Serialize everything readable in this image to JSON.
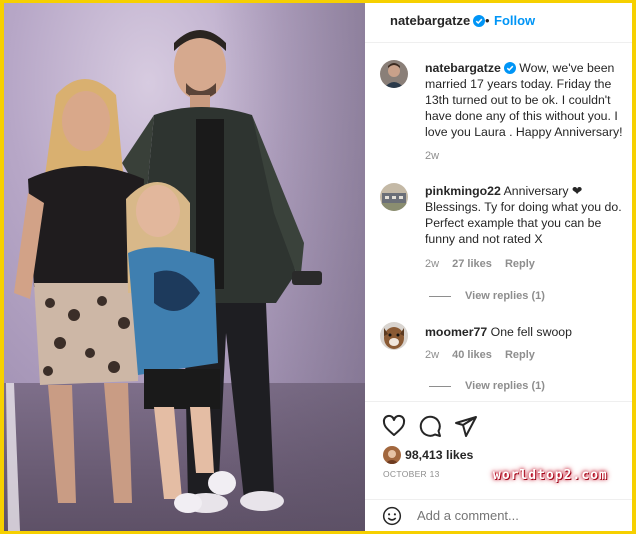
{
  "post": {
    "username": "natebargatze",
    "follow_label": "Follow",
    "dot": "•",
    "caption": {
      "username": "natebargatze",
      "text": "Wow, we've been married 17 years today. Friday the 13th turned out to be ok. I couldn't have done any of this without you. I love you Laura . Happy Anniversary!",
      "time": "2w"
    },
    "comments": [
      {
        "username": "pinkmingo22",
        "text": "Anniversary ❤ Blessings. Ty for doing what you do. Perfect example that you can be funny and not rated X",
        "time": "2w",
        "likes": "27 likes",
        "reply": "Reply",
        "view_replies": "View replies (1)"
      },
      {
        "username": "moomer77",
        "text": "One fell swoop",
        "time": "2w",
        "likes": "40 likes",
        "reply": "Reply",
        "view_replies": "View replies (1)"
      }
    ],
    "likes_count": "98,413 likes",
    "date": "OCTOBER 13",
    "add_comment_placeholder": "Add a comment...",
    "watermark": "worldtop2.com"
  },
  "icons": [
    "verified-badge-icon",
    "heart-icon",
    "comment-icon",
    "share-icon",
    "emoji-icon"
  ],
  "colors": {
    "accent": "#0095f6",
    "verified": "#0095f6",
    "frame": "#f6d000",
    "heart_emoji": "#e0245e"
  }
}
